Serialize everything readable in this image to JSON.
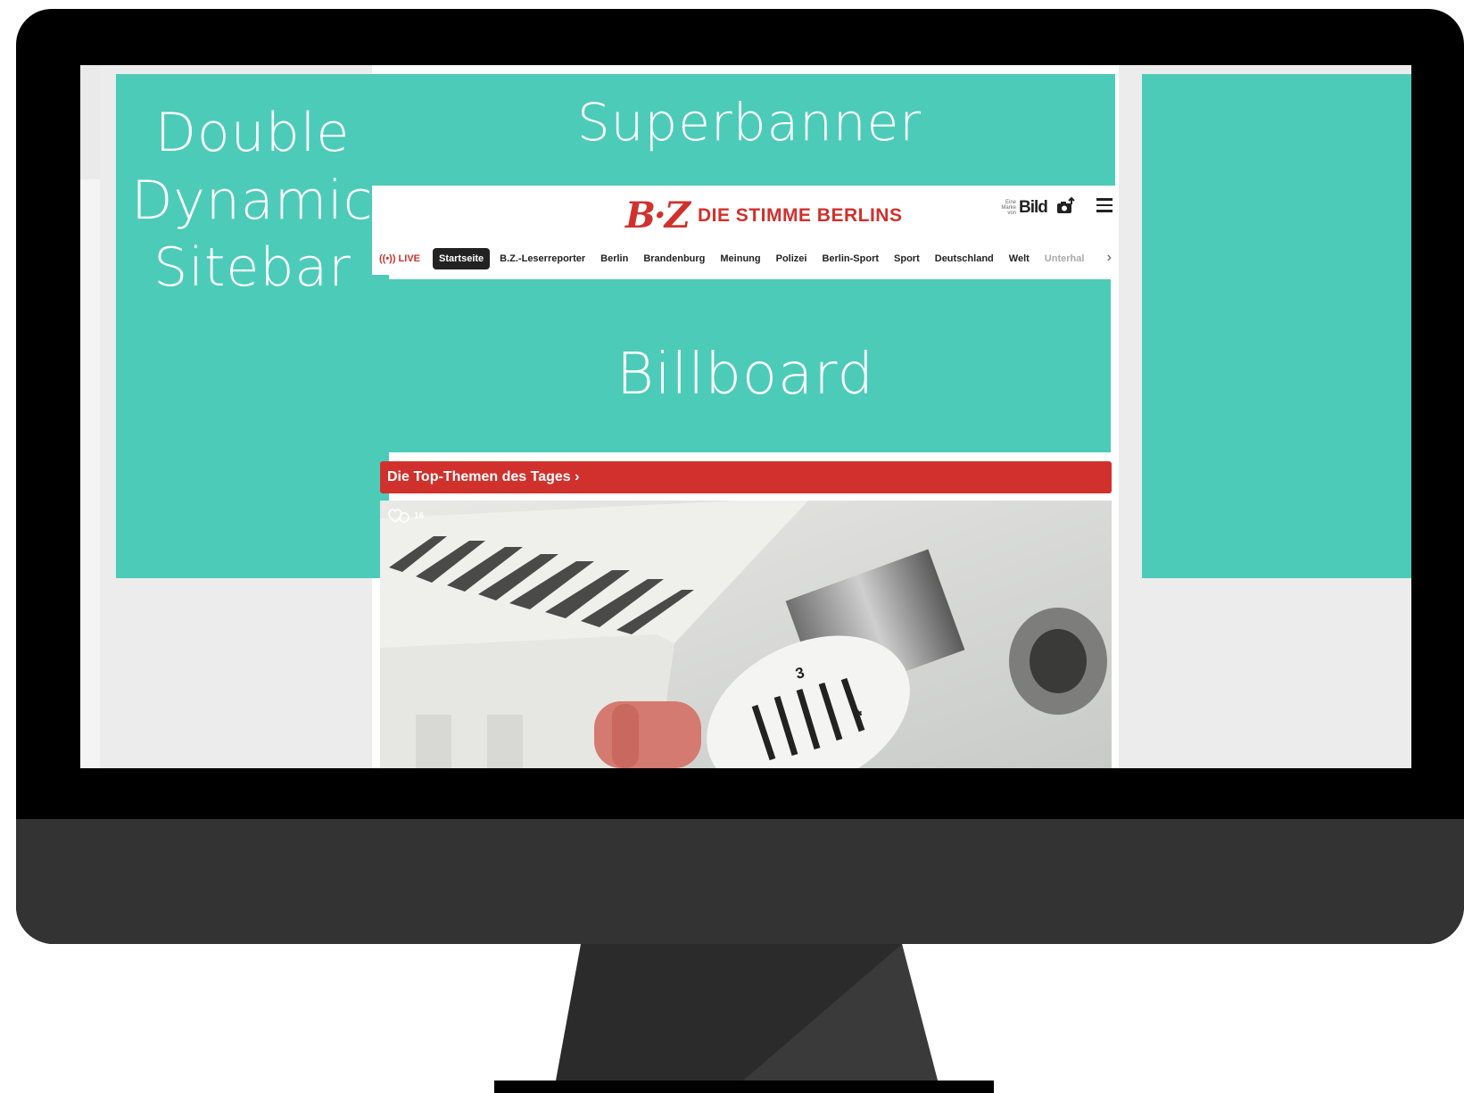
{
  "ads": {
    "left": "Double Dynamic Sitebar",
    "superbanner": "Superbanner",
    "billboard": "Billboard"
  },
  "header": {
    "logo": "B·Z",
    "slogan": "DIE STIMME BERLINS",
    "brand_note": "Eine Marke von",
    "brand": "Bild"
  },
  "nav": {
    "live": "((•)) LIVE",
    "items": [
      "Startseite",
      "B.Z.-Leserreporter",
      "Berlin",
      "Brandenburg",
      "Meinung",
      "Polizei",
      "Berlin-Sport",
      "Sport",
      "Deutschland",
      "Welt",
      "Unterhal"
    ],
    "next": "›"
  },
  "top_themes": "Die Top-Themen des Tages ›",
  "photo": {
    "likes": "16",
    "dial_numbers": [
      "3",
      "4"
    ]
  },
  "colors": {
    "ad": "#4ccbb9",
    "brand_red": "#d0312d",
    "frame": "#000000",
    "chin": "#333333"
  }
}
